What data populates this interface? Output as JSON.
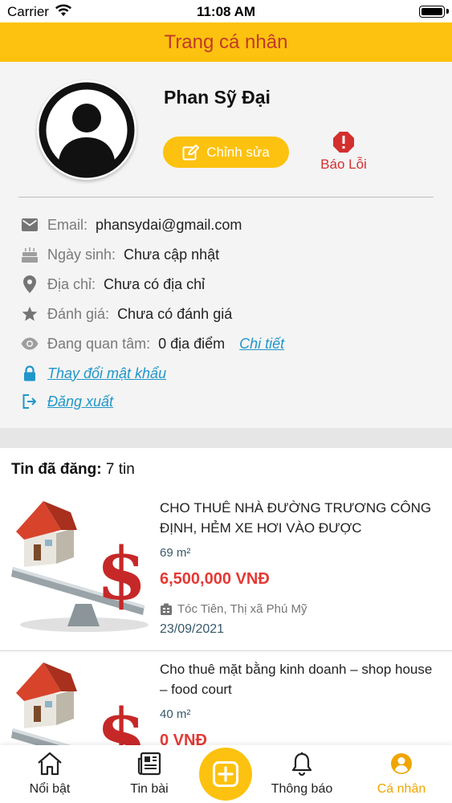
{
  "status_bar": {
    "carrier": "Carrier",
    "time": "11:08 AM"
  },
  "header": {
    "title": "Trang cá nhân"
  },
  "profile": {
    "name": "Phan Sỹ Đại",
    "edit_label": "Chỉnh sửa",
    "report_label": "Báo Lỗi",
    "rows": {
      "email": {
        "label": "Email:",
        "value": "phansydai@gmail.com"
      },
      "birthday": {
        "label": "Ngày sinh:",
        "value": "Chưa cập nhật"
      },
      "address": {
        "label": "Địa chỉ:",
        "value": "Chưa có địa chỉ"
      },
      "rating": {
        "label": "Đánh giá:",
        "value": "Chưa có đánh giá"
      },
      "interest": {
        "label": "Đang quan tâm:",
        "value": "0 địa điểm",
        "link": "Chi tiết"
      }
    },
    "change_password": "Thay đổi mật khẩu",
    "logout": "Đăng xuất"
  },
  "posts": {
    "heading": "Tin đã đăng:",
    "count": "7 tin",
    "items": [
      {
        "title": "CHO THUÊ NHÀ ĐƯỜNG TRƯƠNG CÔNG ĐỊNH, HẺM XE HƠI VÀO ĐƯỢC",
        "area": "69 m²",
        "price": "6,500,000 VNĐ",
        "location": "Tóc Tiên, Thị xã Phú Mỹ",
        "date": "23/09/2021"
      },
      {
        "title": "Cho thuê mặt bằng kinh doanh – shop house – food court",
        "area": "40 m²",
        "price": "0 VNĐ"
      }
    ]
  },
  "tabbar": {
    "items": [
      {
        "label": "Nổi bật",
        "icon": "home-icon"
      },
      {
        "label": "Tin bài",
        "icon": "news-icon"
      },
      {
        "label": "Thông báo",
        "icon": "bell-icon"
      },
      {
        "label": "Cá nhân",
        "icon": "user-circle-icon",
        "active": true
      }
    ],
    "add_icon": "plus-icon"
  },
  "colors": {
    "accent": "#fdc20f",
    "title_red": "#c0392b",
    "price_red": "#e53935",
    "link_blue": "#2196c9",
    "active_tab": "#f0a500"
  }
}
